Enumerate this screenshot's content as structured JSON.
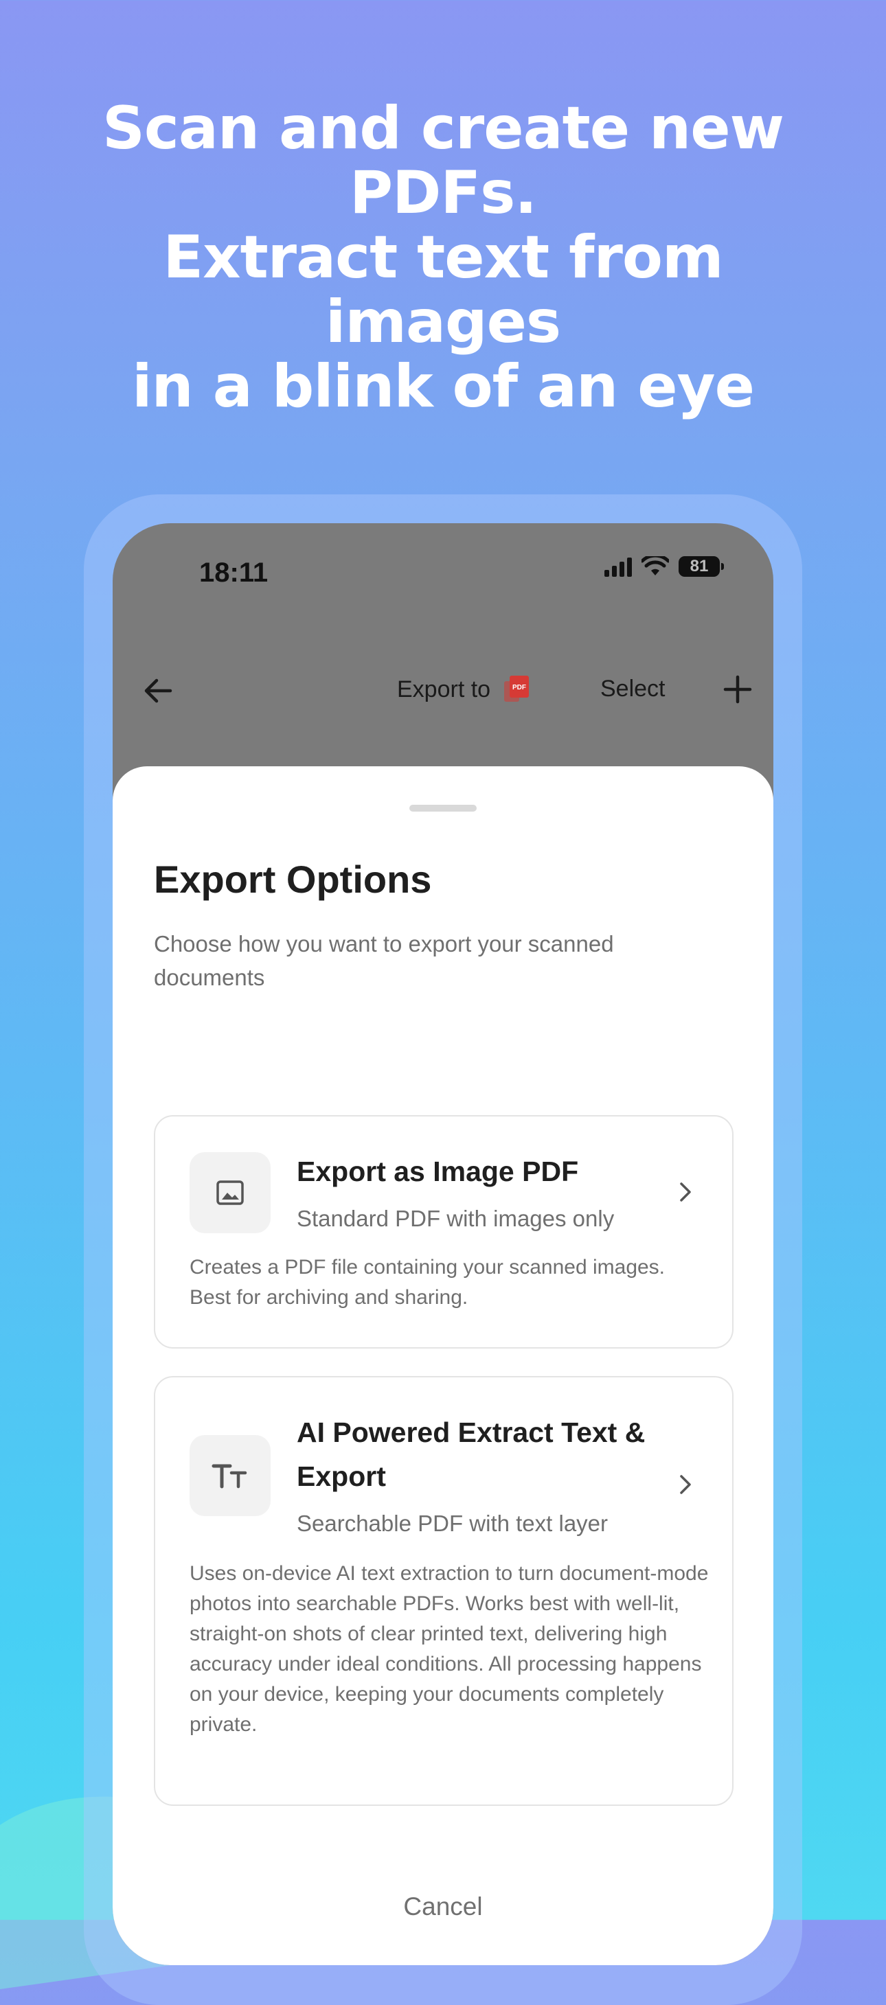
{
  "headline": {
    "line1": "Scan and create new",
    "line2": "PDFs.",
    "line3": "Extract text from images",
    "line4": "in a blink of an eye"
  },
  "status_bar": {
    "time": "18:11",
    "battery": "81"
  },
  "toolbar": {
    "export_label": "Export to",
    "pdf_icon_text": "PDF",
    "select_label": "Select"
  },
  "sheet": {
    "title": "Export Options",
    "subtitle": "Choose how you want to export your scanned documents",
    "options": [
      {
        "icon": "image-icon",
        "title": "Export as Image PDF",
        "subtitle": "Standard PDF with images only",
        "description": "Creates a PDF file containing your scanned images. Best for archiving and sharing."
      },
      {
        "icon": "text-size-icon",
        "title": "AI Powered Extract Text & Export",
        "subtitle": "Searchable PDF with text layer",
        "description": "Uses on-device AI text extraction to turn document-mode photos into searchable PDFs. Works best with well-lit, straight-on shots of clear printed text, delivering high accuracy under ideal conditions. All processing happens on your device, keeping your documents completely private."
      }
    ],
    "cancel_label": "Cancel"
  },
  "colors": {
    "pdf_red": "#d63a35",
    "dim_overlay": "#7b7b7b",
    "sheet_bg": "#ffffff"
  }
}
